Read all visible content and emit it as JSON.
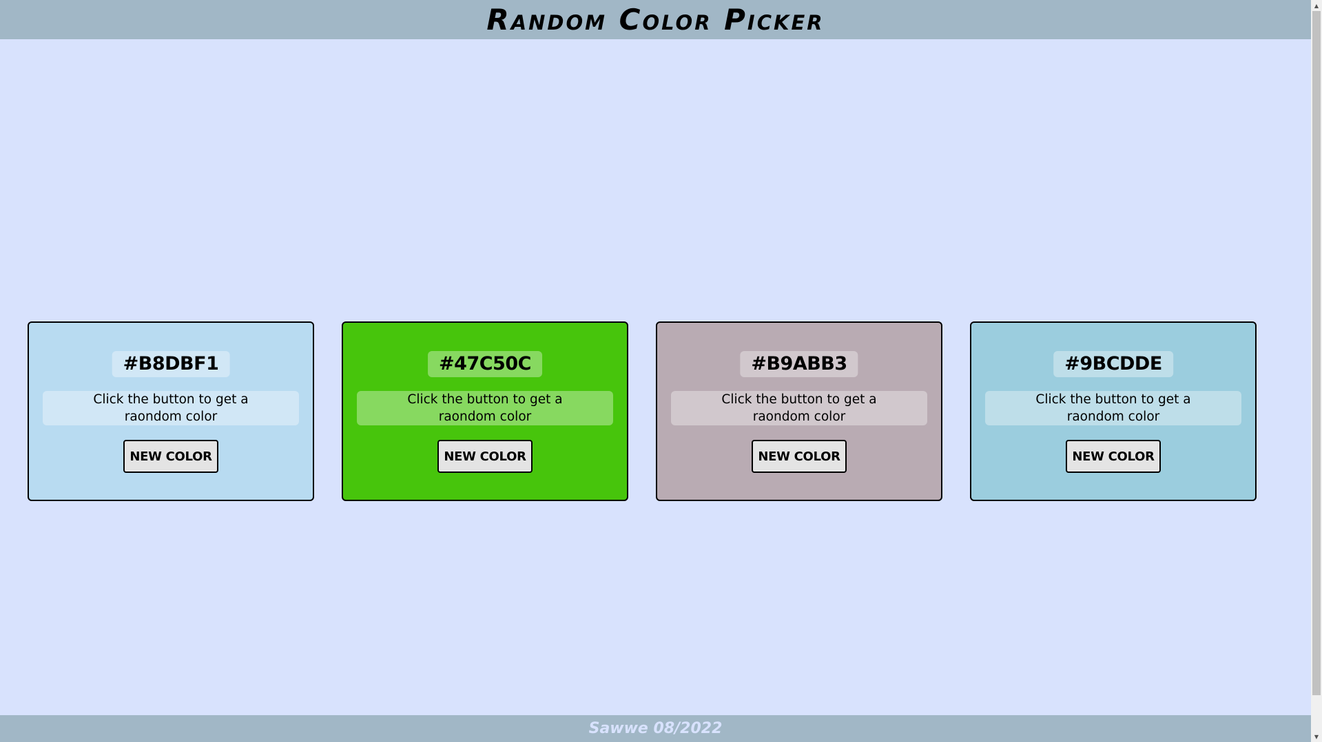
{
  "header": {
    "title": "Random Color Picker",
    "background_color": "#a1b7c6"
  },
  "page": {
    "background_color": "#d8e2fd"
  },
  "cards": [
    {
      "hex": "#B8DBF1",
      "background_color": "#b8dbf1",
      "hint": "Click the button to get a raondom color",
      "button_label": "NEW COLOR"
    },
    {
      "hex": "#47C50C",
      "background_color": "#47c50c",
      "hint": "Click the button to get a raondom color",
      "button_label": "NEW COLOR"
    },
    {
      "hex": "#B9ABB3",
      "background_color": "#b9abb3",
      "hint": "Click the button to get a raondom color",
      "button_label": "NEW COLOR"
    },
    {
      "hex": "#9BCDDE",
      "background_color": "#9bcdde",
      "hint": "Click the button to get a raondom color",
      "button_label": "NEW COLOR"
    }
  ],
  "footer": {
    "credit": "Sawwe 08/2022"
  },
  "scrollbar": {
    "up_icon": "scroll-up-arrow-icon",
    "down_icon": "scroll-down-arrow-icon"
  }
}
